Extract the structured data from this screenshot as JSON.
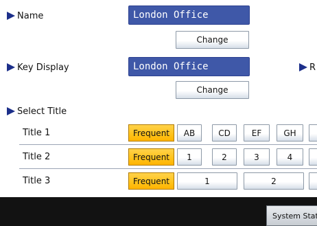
{
  "name_section": {
    "label": "Name",
    "value": "London Office",
    "change_label": "Change"
  },
  "key_display_section": {
    "label": "Key Display",
    "value": "London Office",
    "change_label": "Change",
    "right_label_fragment": "R"
  },
  "select_title": {
    "label": "Select Title",
    "rows": [
      {
        "title": "Title 1",
        "frequent": "Frequent",
        "keys": [
          "AB",
          "CD",
          "EF",
          "GH"
        ]
      },
      {
        "title": "Title 2",
        "frequent": "Frequent",
        "keys": [
          "1",
          "2",
          "3",
          "4"
        ]
      },
      {
        "title": "Title 3",
        "frequent": "Frequent",
        "keys": [
          "1",
          "2"
        ]
      }
    ]
  },
  "status_bar": {
    "system_status_label": "System Statu"
  },
  "colors": {
    "lcd": "#3f58a8",
    "frequent": "#ffc21a",
    "arrow": "#1c2f8a",
    "bottom_bar": "#121212"
  }
}
